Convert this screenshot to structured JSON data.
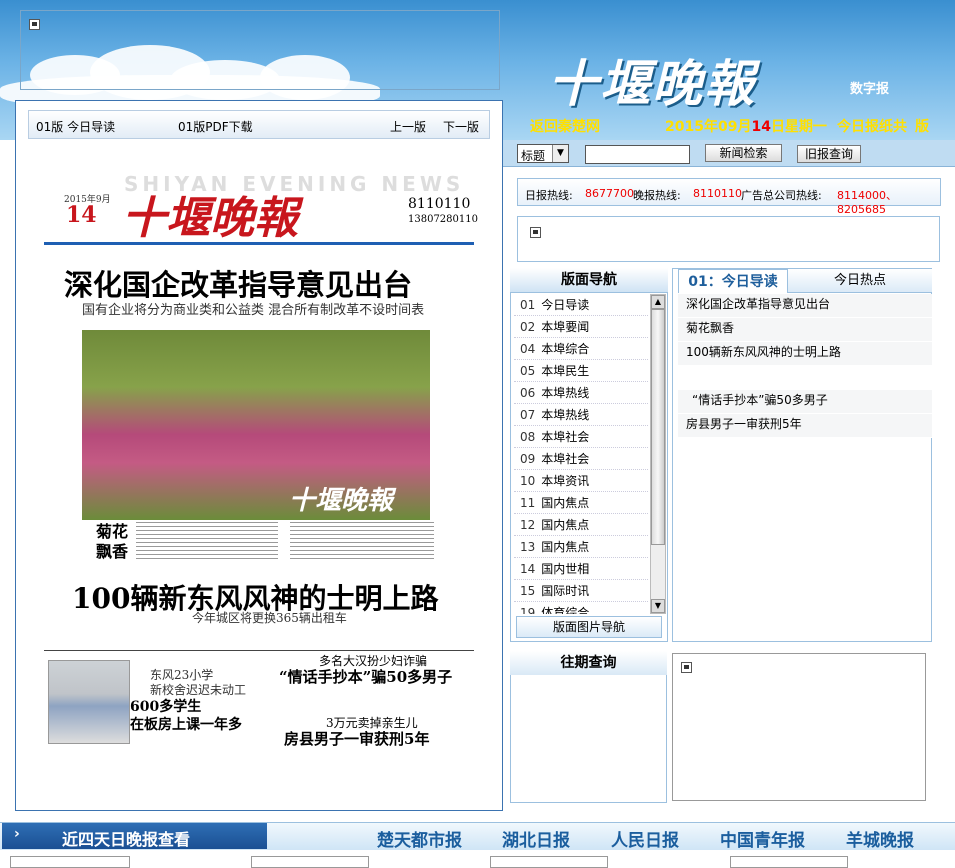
{
  "header": {
    "logo": "十堰晚報",
    "logo_sub": "数字报",
    "back_link": "返回秦楚网",
    "date_prefix": "2015年09月",
    "date_day": "14",
    "date_suffix": "日星期一",
    "total_prefix": "今日报纸共",
    "total_suffix": "版"
  },
  "paper_toolbar": {
    "current": "01版  今日导读",
    "pdf": "01版PDF下载",
    "prev": "上一版",
    "next": "下一版"
  },
  "paper": {
    "banner_en": "SHIYAN EVENING NEWS",
    "title": "十堰晚報",
    "date": "2015年9月",
    "day": "14",
    "hotline": "8110110",
    "hotline2": "13807280110",
    "headline1": "深化国企改革指导意见出台",
    "sub1": "国有企业将分为商业类和公益类    混合所有制改革不设时间表",
    "photo_caption": "十堰晚報",
    "juhua": "菊花\n飘香",
    "headline2": "100辆新东风风神的士明上路",
    "sub2": "今年城区将更换365辆出租车",
    "story1a": "东风23小学\n新校舍迟迟未动工",
    "story1b": "600多学生\n在板房上课一年多",
    "story2a": "多名大汉扮少妇诈骗",
    "story2b": "“情话手抄本”骗50多男子",
    "story3a": "3万元卖掉亲生儿",
    "story3b": "房县男子一审获刑5年"
  },
  "search": {
    "select_value": "标题",
    "input_value": "",
    "search_btn": "新闻检索",
    "old_btn": "旧报查询"
  },
  "hotlines": {
    "daily_label": "日报热线:",
    "daily": "8677700",
    "evening_label": "晚报热线:",
    "evening": "8110110",
    "ad_label": "广告总公司热线:",
    "ad": "8114000、8205685"
  },
  "page_nav": {
    "title": "版面导航",
    "items": [
      {
        "n": "01",
        "label": "今日导读"
      },
      {
        "n": "02",
        "label": "本埠要闻"
      },
      {
        "n": "04",
        "label": "本埠综合"
      },
      {
        "n": "05",
        "label": "本埠民生"
      },
      {
        "n": "06",
        "label": "本埠热线"
      },
      {
        "n": "07",
        "label": "本埠热线"
      },
      {
        "n": "08",
        "label": "本埠社会"
      },
      {
        "n": "09",
        "label": "本埠社会"
      },
      {
        "n": "10",
        "label": "本埠资讯"
      },
      {
        "n": "11",
        "label": "国内焦点"
      },
      {
        "n": "12",
        "label": "国内焦点"
      },
      {
        "n": "13",
        "label": "国内焦点"
      },
      {
        "n": "14",
        "label": "国内世相"
      },
      {
        "n": "15",
        "label": "国际时讯"
      },
      {
        "n": "19",
        "label": "体育综合"
      }
    ],
    "image_nav": "版面图片导航"
  },
  "articles": {
    "tab_active": "01：今日导读",
    "tab_other": "今日热点",
    "items": [
      "深化国企改革指导意见出台",
      "菊花飘香",
      "100辆新东风风神的士明上路",
      "",
      "“情话手抄本”骗50多男子",
      "房县男子一审获刑5年"
    ]
  },
  "past": {
    "title": "往期查询"
  },
  "bottom": {
    "recent": "近四天日晚报查看",
    "links": [
      "楚天都市报",
      "湖北日报",
      "人民日报",
      "中国青年报",
      "羊城晚报"
    ]
  }
}
